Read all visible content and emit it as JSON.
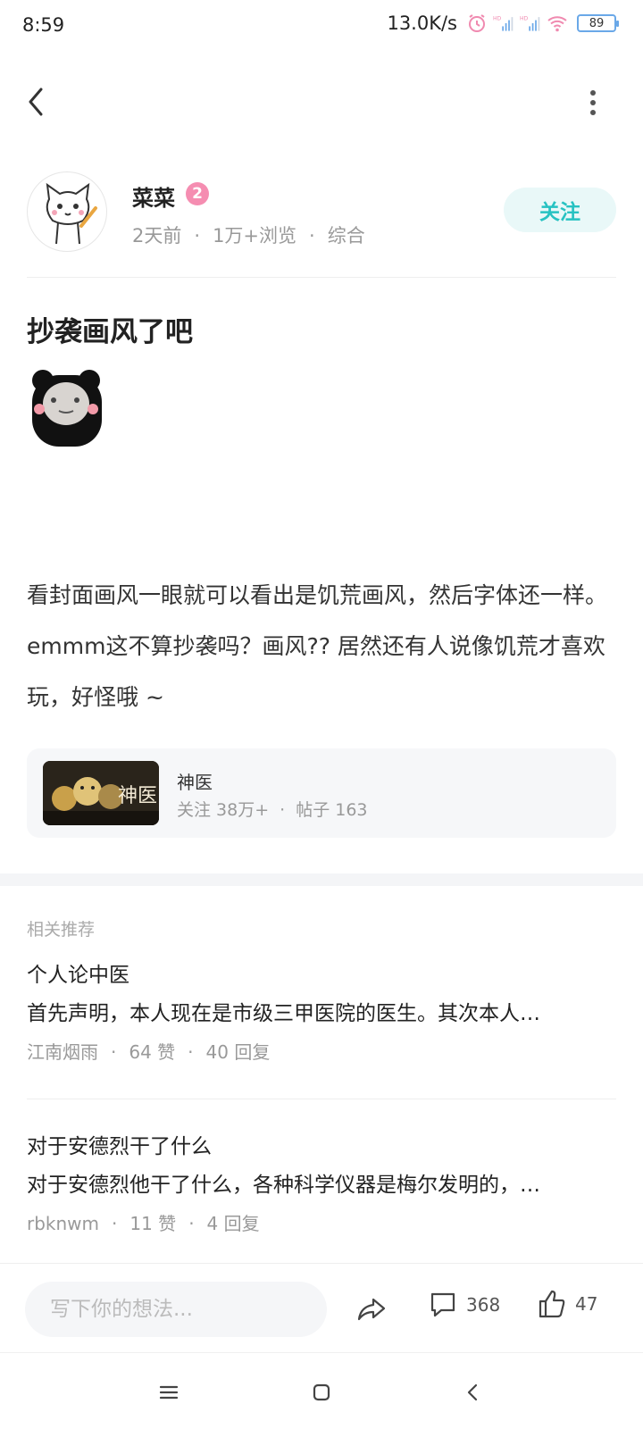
{
  "status_bar": {
    "time": "8:59",
    "net_speed": "13.0K/s",
    "battery": "89",
    "icons": [
      "alarm-icon",
      "signal-hd-icon",
      "signal-hd-icon",
      "wifi-icon"
    ]
  },
  "header": {
    "back_icon": "chevron-left-icon",
    "more_icon": "more-vertical-icon"
  },
  "author": {
    "name": "菜菜",
    "level": "2",
    "time_ago": "2天前",
    "views": "1万+浏览",
    "category": "综合",
    "follow_label": "关注"
  },
  "post": {
    "title": "抄袭画风了吧",
    "body": "看封面画风一眼就可以看出是饥荒画风，然后字体还一样。emmm这不算抄袭吗？画风?? 居然还有人说像饥荒才喜欢玩，好怪哦 ~"
  },
  "game_card": {
    "name": "神医",
    "followers": "关注 38万+",
    "posts": "帖子 163",
    "thumb_text": "神医"
  },
  "recommendations": {
    "header": "相关推荐",
    "items": [
      {
        "title": "个人论中医",
        "snippet": "首先声明，本人现在是市级三甲医院的医生。其次本人…",
        "author": "江南烟雨",
        "likes": "64 赞",
        "replies": "40 回复"
      },
      {
        "title": "对于安德烈干了什么",
        "snippet": "对于安德烈他干了什么，各种科学仪器是梅尔发明的，…",
        "author": "rbknwm",
        "likes": "11 赞",
        "replies": "4 回复"
      }
    ]
  },
  "bottom_bar": {
    "input_placeholder": "写下你的想法...",
    "comment_count": "368",
    "like_count": "47"
  },
  "colors": {
    "accent": "#27c2c2",
    "follow_bg": "#e9f8f8",
    "level_badge": "#f58db1",
    "muted_text": "#999999"
  }
}
